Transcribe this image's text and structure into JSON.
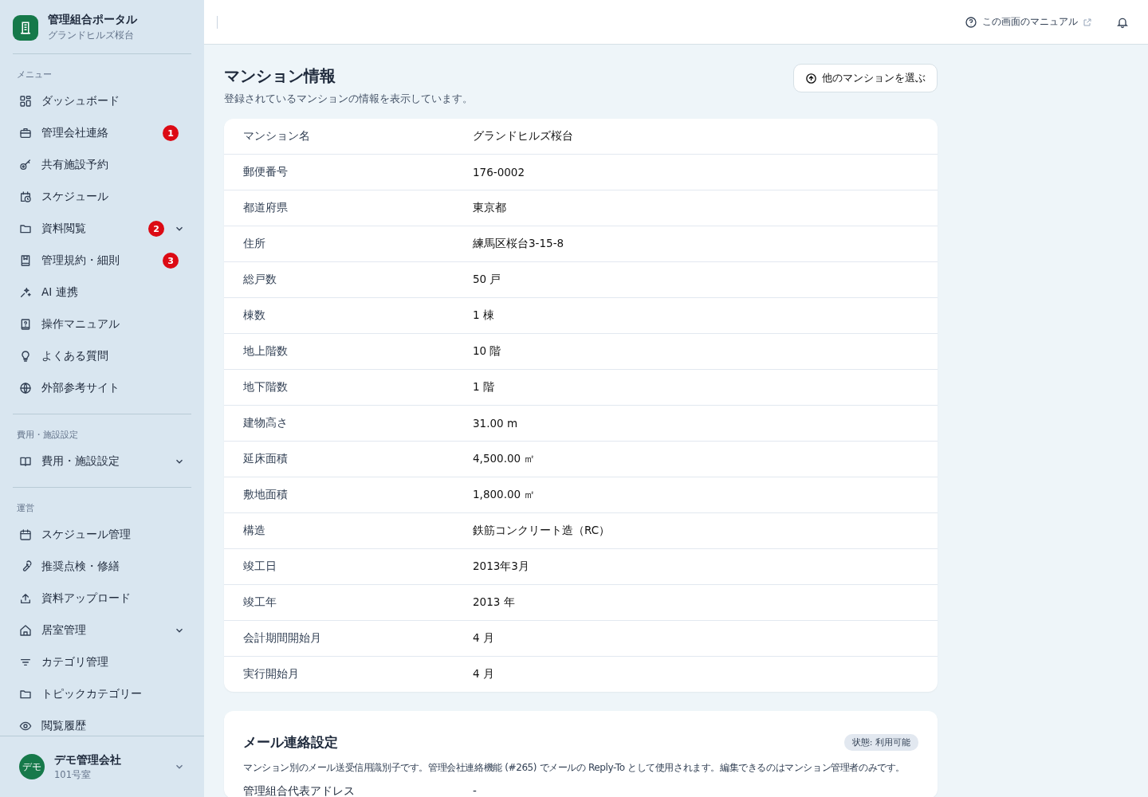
{
  "sidebar": {
    "app_title": "管理組合ポータル",
    "app_subtitle": "グランドヒルズ桜台",
    "sections": [
      {
        "heading": "メニュー",
        "items": [
          {
            "label": "ダッシュボード"
          },
          {
            "label": "管理会社連絡",
            "badge": "1"
          },
          {
            "label": "共有施設予約"
          },
          {
            "label": "スケジュール"
          },
          {
            "label": "資料閲覧",
            "badge": "2",
            "expandable": true
          },
          {
            "label": "管理規約・細則",
            "badge": "3"
          },
          {
            "label": "AI 連携"
          },
          {
            "label": "操作マニュアル"
          },
          {
            "label": "よくある質問"
          },
          {
            "label": "外部参考サイト"
          }
        ]
      },
      {
        "heading": "費用・施設設定",
        "items": [
          {
            "label": "費用・施設設定",
            "expandable": true
          }
        ]
      },
      {
        "heading": "運営",
        "items": [
          {
            "label": "スケジュール管理"
          },
          {
            "label": "推奨点検・修繕"
          },
          {
            "label": "資料アップロード"
          },
          {
            "label": "居室管理",
            "expandable": true
          },
          {
            "label": "カテゴリ管理"
          },
          {
            "label": "トピックカテゴリー"
          },
          {
            "label": "閲覧履歴"
          }
        ]
      }
    ],
    "user": {
      "avatar": "デモ",
      "name": "デモ管理会社",
      "room": "101号室"
    }
  },
  "header": {
    "manual_link": "この画面のマニュアル"
  },
  "page": {
    "title": "マンション情報",
    "subtitle": "登録されているマンションの情報を表示しています。",
    "select_button": "他のマンションを選ぶ"
  },
  "info_table": [
    {
      "label": "マンション名",
      "value": "グランドヒルズ桜台"
    },
    {
      "label": "郵便番号",
      "value": "176-0002"
    },
    {
      "label": "都道府県",
      "value": "東京都"
    },
    {
      "label": "住所",
      "value": "練馬区桜台3-15-8"
    },
    {
      "label": "総戸数",
      "value": "50 戸"
    },
    {
      "label": "棟数",
      "value": "1 棟"
    },
    {
      "label": "地上階数",
      "value": "10 階"
    },
    {
      "label": "地下階数",
      "value": "1 階"
    },
    {
      "label": "建物高さ",
      "value": "31.00 m"
    },
    {
      "label": "延床面積",
      "value": "4,500.00 ㎡"
    },
    {
      "label": "敷地面積",
      "value": "1,800.00 ㎡"
    },
    {
      "label": "構造",
      "value": "鉄筋コンクリート造（RC）"
    },
    {
      "label": "竣工日",
      "value": "2013年3月"
    },
    {
      "label": "竣工年",
      "value": "2013 年"
    },
    {
      "label": "会計期間開始月",
      "value": "4 月"
    },
    {
      "label": "実行開始月",
      "value": "4 月"
    }
  ],
  "mail_settings": {
    "title": "メール連絡設定",
    "status": "状態: 利用可能",
    "description": "マンション別のメール送受信用識別子です。管理会社連絡機能 (#265) でメールの Reply-To として使用されます。編集できるのはマンション管理者のみです。",
    "rows": [
      {
        "label": "管理組合代表アドレス",
        "value": "-"
      }
    ]
  }
}
